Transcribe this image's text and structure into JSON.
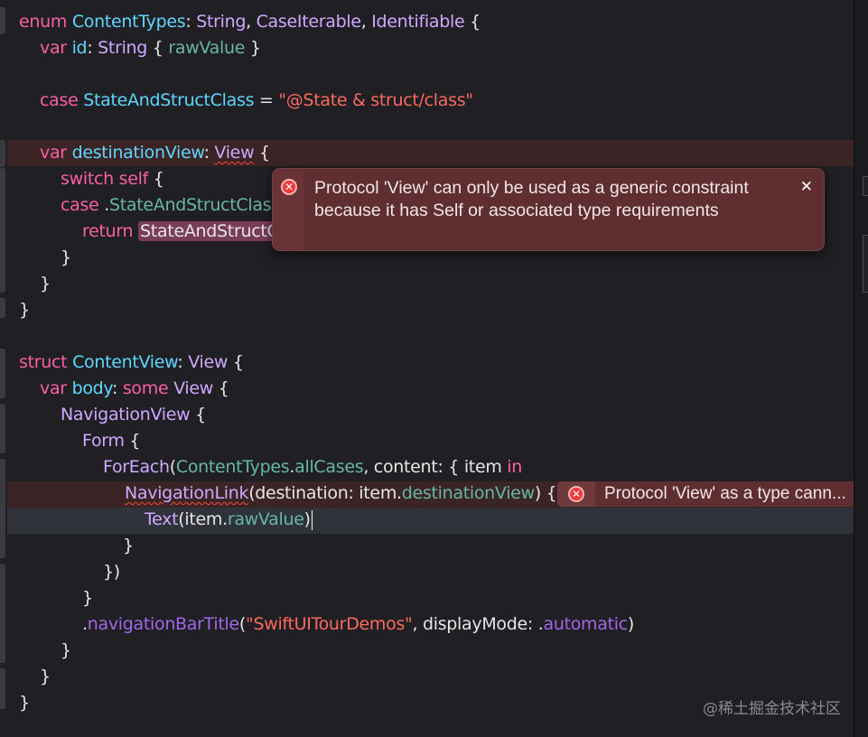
{
  "editor": {
    "l1": {
      "a": "enum",
      "b": "ContentTypes",
      "c": ": ",
      "d": "String",
      "e": ", ",
      "f": "CaseIterable",
      "g": ", ",
      "h": "Identifiable",
      "i": " {"
    },
    "l2": {
      "a": "var",
      "b": "id",
      "c": ": ",
      "d": "String",
      "e": " { ",
      "f": "rawValue",
      "g": " }"
    },
    "l4": {
      "a": "case",
      "b": "StateAndStructClass",
      "c": " = ",
      "d": "\"@State & struct/class\""
    },
    "l6": {
      "a": "var",
      "b": "destinationView",
      "c": ": ",
      "d": "View",
      "e": " {"
    },
    "l7": {
      "a": "switch",
      "b": "self",
      "c": " {"
    },
    "l8": {
      "a": "case",
      "b": " .",
      "c": "StateAndStructClass"
    },
    "l9": {
      "a": "return",
      "b": "StateAndStructC"
    },
    "l10": "}",
    "l11": "}",
    "l12": "}",
    "l14": {
      "a": "struct",
      "b": "ContentView",
      "c": ": ",
      "d": "View",
      "e": " {"
    },
    "l15": {
      "a": "var",
      "b": "body",
      "c": ": ",
      "d": "some",
      "e": "View",
      "f": " {"
    },
    "l16": {
      "a": "NavigationView",
      "b": " {"
    },
    "l17": {
      "a": "Form",
      "b": " {"
    },
    "l18": {
      "a": "ForEach",
      "b": "(",
      "c": "ContentTypes",
      "d": ".",
      "e": "allCases",
      "f": ", content: { item ",
      "g": "in"
    },
    "l19": {
      "a": "NavigationLink",
      "b": "(destination: item.",
      "c": "destinationView",
      "d": ") {"
    },
    "l20": {
      "a": "Text",
      "b": "(item.",
      "c": "rawValue",
      "d": ")"
    },
    "l21": "}",
    "l22": "})",
    "l23": "}",
    "l24": {
      "a": ".",
      "b": "navigationBarTitle",
      "c": "(",
      "d": "\"SwiftUITourDemos\"",
      "e": ", displayMode: .",
      "f": "automatic",
      "g": ")"
    },
    "l25": "}",
    "l26": "}",
    "l27": "}"
  },
  "popover": {
    "message": "Protocol 'View' can only be used as a generic constraint because it has Self or associated type requirements",
    "close_label": "✕"
  },
  "inline_error": {
    "text": "Protocol 'View' as a type cann..."
  },
  "watermark": "@稀土掘金技术社区",
  "colors": {
    "background": "#1f1f24",
    "keyword": "#fc5fa3",
    "type": "#d0a8ff",
    "declaration": "#5dd8ff",
    "project": "#67b7a4",
    "method": "#a167e6",
    "string": "#fc6a5d",
    "error": "#ee3b3b"
  },
  "icons": [
    "error-icon",
    "close-icon"
  ]
}
